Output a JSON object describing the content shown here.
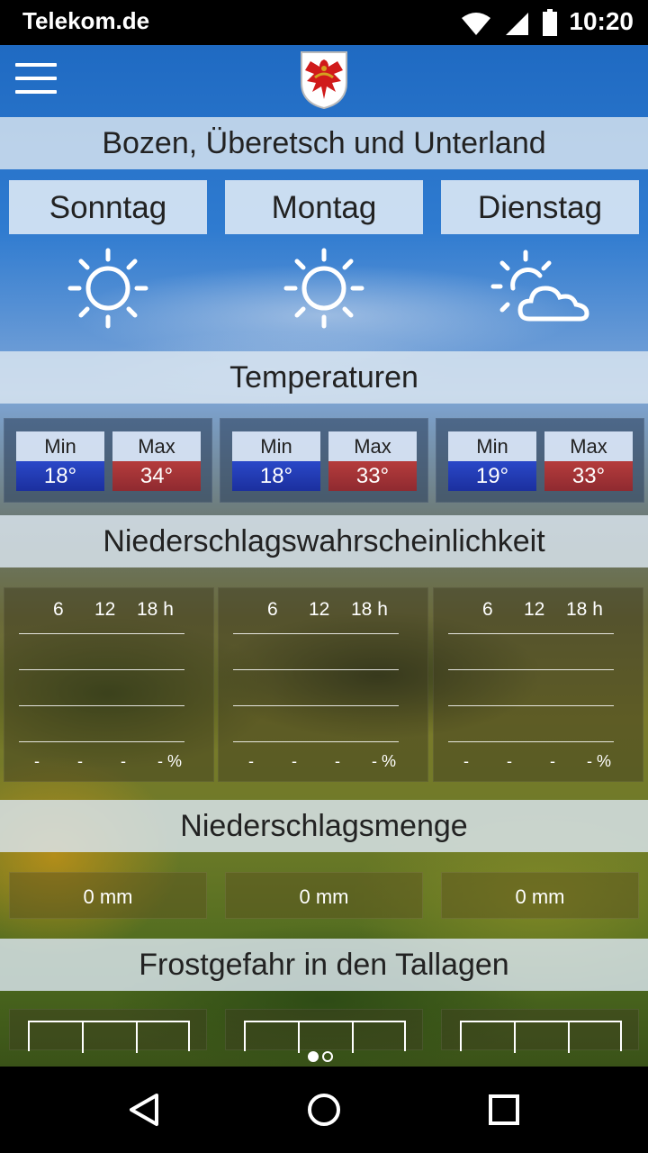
{
  "status_bar": {
    "carrier": "Telekom.de",
    "time": "10:20",
    "icons": [
      "wifi-icon",
      "signal-icon",
      "battery-icon"
    ]
  },
  "app": {
    "crest_icon": "tyrol-eagle-crest",
    "region_title": "Bozen, Überetsch und Unterland",
    "days": [
      {
        "name": "Sonntag",
        "icon": "sun-icon"
      },
      {
        "name": "Montag",
        "icon": "sun-icon"
      },
      {
        "name": "Dienstag",
        "icon": "sun-cloud-icon"
      }
    ]
  },
  "temperatures": {
    "title": "Temperaturen",
    "min_label": "Min",
    "max_label": "Max",
    "days": [
      {
        "min": "18°",
        "max": "34°"
      },
      {
        "min": "18°",
        "max": "33°"
      },
      {
        "min": "19°",
        "max": "33°"
      }
    ]
  },
  "precip_probability": {
    "title": "Niederschlagswahrscheinlichkeit",
    "hours": [
      "6",
      "12",
      "18 h"
    ],
    "days": [
      {
        "values": [
          "-",
          "-",
          "-",
          "- %"
        ]
      },
      {
        "values": [
          "-",
          "-",
          "-",
          "- %"
        ]
      },
      {
        "values": [
          "-",
          "-",
          "-",
          "- %"
        ]
      }
    ]
  },
  "precip_amount": {
    "title": "Niederschlagsmenge",
    "days": [
      "0 mm",
      "0 mm",
      "0 mm"
    ]
  },
  "frost": {
    "title": "Frostgefahr in den Tallagen"
  },
  "pager": {
    "pages": 2,
    "active": 1
  },
  "nav_bar": [
    "back-icon",
    "home-icon",
    "recents-icon"
  ],
  "colors": {
    "min_temp": "#1b2f9e",
    "max_temp": "#8f2a30",
    "header_bg": "#dce6f0"
  }
}
